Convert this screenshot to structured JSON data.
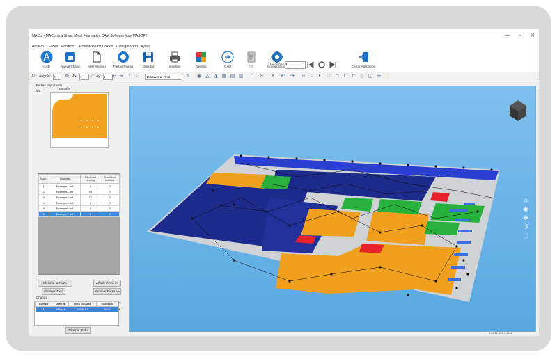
{
  "window": {
    "title": "MACut - MACut is a Sheet Metal Fabrication CAM Software from MASOFT",
    "controls": [
      "—",
      "▫",
      "✕"
    ]
  },
  "menu": [
    "Archivo",
    "Fases",
    "Modificar",
    "Estimación de Costos",
    "Configuración",
    "Ayuda"
  ],
  "toolbar": {
    "buttons": [
      {
        "label": "CAD",
        "icon": "compass-icon"
      },
      {
        "label": "Nueva Chapa",
        "icon": "new-sheet-icon"
      },
      {
        "label": "Abrir Archivo",
        "icon": "open-file-icon"
      },
      {
        "label": "Piezas Planas",
        "icon": "flat-parts-icon"
      },
      {
        "label": "Guardar",
        "icon": "save-icon"
      },
      {
        "label": "Imprimir",
        "icon": "printer-icon"
      },
      {
        "label": "Nesting",
        "icon": "nesting-icon"
      },
      {
        "label": "CAM",
        "icon": "cam-arrow-icon"
      },
      {
        "label": "CN",
        "icon": "nc-code-icon"
      },
      {
        "label": "Configuración",
        "icon": "settings-icon"
      },
      {
        "label": "Cerrar Aplicación",
        "icon": "exit-icon"
      }
    ],
    "speed_label": "Velocidad",
    "speed_value": "4"
  },
  "toolbar2": {
    "angle_label": "Angulo:",
    "angle_value": "0",
    "ax_label": "Ax:",
    "ax_value": "1",
    "ay_label": "Ay:",
    "ay_value": "1",
    "move_mode": "No Mover al Final"
  },
  "left_panel": {
    "imported_label": "Piezas Importadas",
    "size_label": "Tamaño",
    "count": "5/5",
    "table": {
      "headers": [
        "Num.",
        "Nombre",
        "Cantidad Nesting",
        "Cantidad Manual"
      ],
      "rows": [
        [
          "1",
          "Example1.dxf",
          "3",
          "0"
        ],
        [
          "2",
          "Example2.dxf",
          "94",
          "0"
        ],
        [
          "3",
          "Example3.dxf",
          "15",
          "0"
        ],
        [
          "4",
          "Example4.dxf",
          "3",
          "0"
        ],
        [
          "5",
          "Example5.dxf",
          "3",
          "0"
        ],
        [
          "6",
          "Example7.dxf",
          "5",
          "0"
        ]
      ],
      "selected_index": 5
    },
    "delete_part": "Eliminar la Pieza",
    "add_part": "Añadir Pieza >>",
    "delete_all": "Eliminar Todo",
    "delete_part2": "Eliminar Pieza >>",
    "chapas_label": "Chapas",
    "chapas_table": {
      "headers": [
        "Espesor",
        "Material",
        "Area Utilizada",
        "%Utilizada"
      ],
      "rows": [
        [
          "1",
          "0 Steel",
          "28035.07",
          "95.02"
        ]
      ]
    },
    "delete_all_sheets": "Eliminar Todo"
  },
  "viewport": {
    "background": "#6fb4e7",
    "sheet_color": "#c8c8c8",
    "part_colors": [
      "#1c2b8c",
      "#f0a01e",
      "#27b13c",
      "#e6222a"
    ]
  },
  "status": {
    "coordinates": "X:1031.499,Y:1268"
  },
  "nav_icons": [
    "home-icon",
    "view-icon",
    "pan-icon",
    "rotate-icon",
    "fit-icon"
  ]
}
